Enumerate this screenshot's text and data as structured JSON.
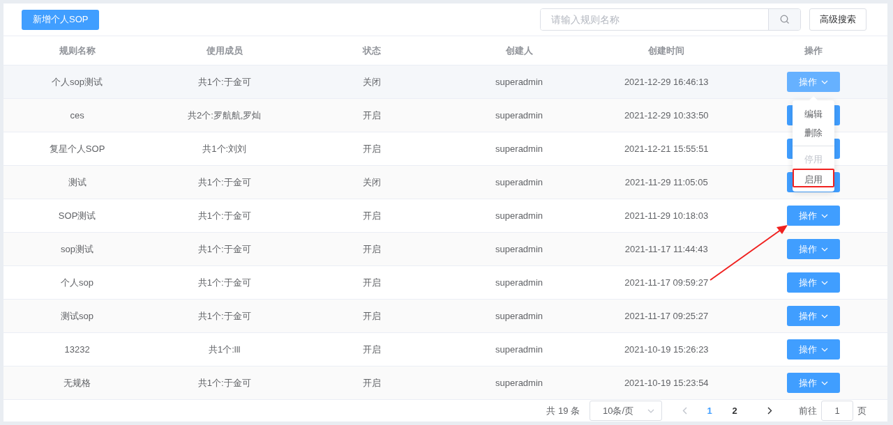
{
  "toolbar": {
    "add_button": "新增个人SOP",
    "search": {
      "placeholder": "请输入规则名称"
    },
    "advanced_button": "高级搜索"
  },
  "table": {
    "columns": [
      "规则名称",
      "使用成员",
      "状态",
      "创建人",
      "创建时间",
      "操作"
    ],
    "rows": [
      {
        "name": "个人sop测试",
        "members": "共1个:于金可",
        "status": "关闭",
        "creator": "superadmin",
        "created": "2021-12-29 16:46:13",
        "action": "操作",
        "menu_open": true
      },
      {
        "name": "ces",
        "members": "共2个:罗航航,罗灿",
        "status": "开启",
        "creator": "superadmin",
        "created": "2021-12-29 10:33:50",
        "menu_open": false
      },
      {
        "name": "复星个人SOP",
        "members": "共1个:刘刘",
        "status": "开启",
        "creator": "superadmin",
        "created": "2021-12-21 15:55:51",
        "menu_open": false
      },
      {
        "name": "测试",
        "members": "共1个:于金可",
        "status": "关闭",
        "creator": "superadmin",
        "created": "2021-11-29 11:05:05",
        "menu_open": false
      },
      {
        "name": "SOP测试",
        "members": "共1个:于金可",
        "status": "开启",
        "creator": "superadmin",
        "created": "2021-11-29 10:18:03",
        "action": "操作",
        "menu_open": false
      },
      {
        "name": "sop测试",
        "members": "共1个:于金可",
        "status": "开启",
        "creator": "superadmin",
        "created": "2021-11-17 11:44:43",
        "action": "操作",
        "menu_open": false
      },
      {
        "name": "个人sop",
        "members": "共1个:于金可",
        "status": "开启",
        "creator": "superadmin",
        "created": "2021-11-17 09:59:27",
        "action": "操作",
        "menu_open": false
      },
      {
        "name": "测试sop",
        "members": "共1个:于金可",
        "status": "开启",
        "creator": "superadmin",
        "created": "2021-11-17 09:25:27",
        "action": "操作",
        "menu_open": false
      },
      {
        "name": "13232",
        "members": "共1个:lll",
        "status": "开启",
        "creator": "superadmin",
        "created": "2021-10-19 15:26:23",
        "action": "操作",
        "menu_open": false
      },
      {
        "name": "无规格",
        "members": "共1个:于金可",
        "status": "开启",
        "creator": "superadmin",
        "created": "2021-10-19 15:23:54",
        "action": "操作",
        "menu_open": false
      }
    ]
  },
  "dropdown": {
    "items": [
      {
        "label": "编辑",
        "disabled": false,
        "highlighted": false,
        "divided": false
      },
      {
        "label": "删除",
        "disabled": false,
        "highlighted": false,
        "divided": false
      },
      {
        "label": "停用",
        "disabled": true,
        "highlighted": false,
        "divided": true
      },
      {
        "label": "启用",
        "disabled": false,
        "highlighted": true,
        "divided": false
      }
    ]
  },
  "pagination": {
    "total": "共 19 条",
    "page_size": "10条/页",
    "pages": [
      {
        "label": "1",
        "selected": true
      },
      {
        "label": "2",
        "selected": false
      }
    ],
    "goto_label": "前往",
    "goto_value": "1",
    "goto_suffix": "页"
  }
}
